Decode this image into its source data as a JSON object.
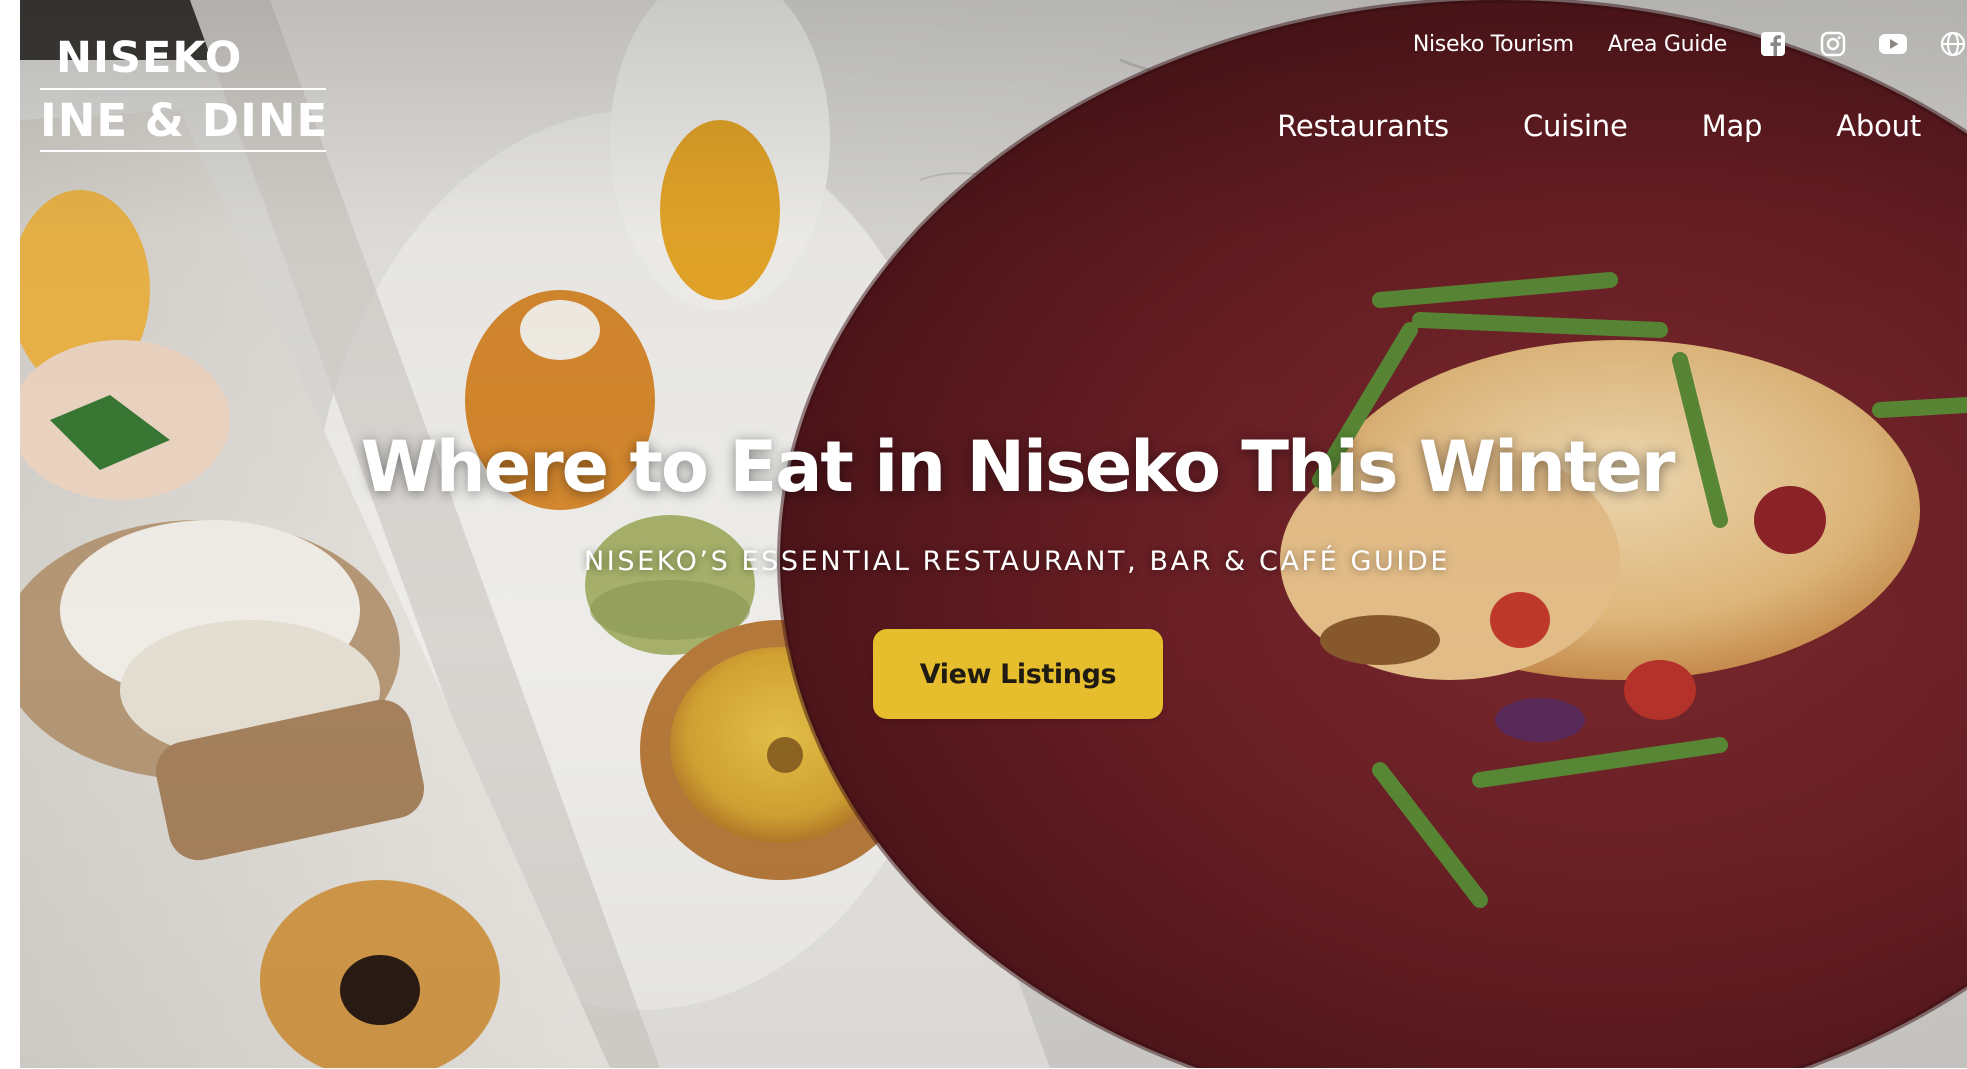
{
  "site": {
    "logo_line_1": "NISEKO",
    "logo_line_2": "INE & DINE"
  },
  "utility_nav": {
    "links": [
      {
        "label": "Niseko Tourism"
      },
      {
        "label": "Area Guide"
      }
    ],
    "icons": [
      "facebook-icon",
      "instagram-icon",
      "youtube-icon",
      "globe-icon"
    ]
  },
  "main_nav": {
    "items": [
      {
        "label": "Restaurants"
      },
      {
        "label": "Cuisine"
      },
      {
        "label": "Map"
      },
      {
        "label": "About"
      }
    ]
  },
  "hero": {
    "title": "Where to Eat in Niseko This Winter",
    "subtitle": "NISEKO’S ESSENTIAL RESTAURANT, BAR & CAFÉ GUIDE",
    "cta_label": "View Listings",
    "image_description_icon": "plated-food-photo"
  },
  "colors": {
    "cta_background": "#e6bd2c",
    "cta_text": "#1f1b12",
    "text_on_image": "#ffffff",
    "plate_maroon": "#6d1f24",
    "marble_grey": "#d8d6d2"
  }
}
